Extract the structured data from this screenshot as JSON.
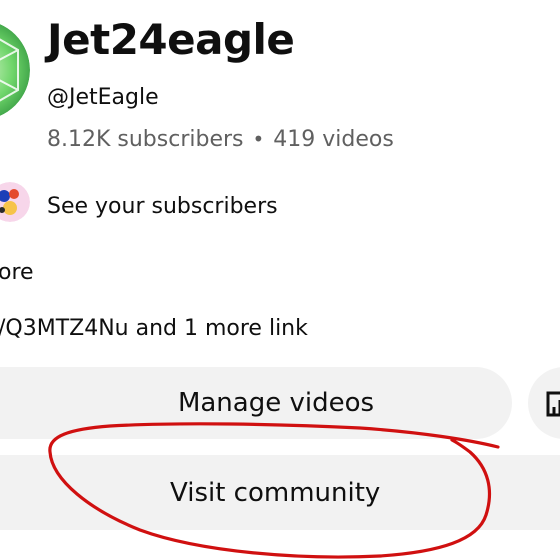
{
  "channel": {
    "name": "Jet24eagle",
    "handle": "@JetEagle",
    "subscribers": "8.12K subscribers",
    "separator": "•",
    "videos": "419 videos"
  },
  "subscribers_link": {
    "label": "See your subscribers"
  },
  "description": {
    "more_text": "ore"
  },
  "links": {
    "text": "/Q3MTZ4Nu and 1 more link"
  },
  "actions": {
    "manage_videos": "Manage videos",
    "visit_community": "Visit community"
  },
  "annotation": {
    "color": "#d01010"
  },
  "icons": {
    "avatar": "channel-avatar",
    "subscriber_avatar": "subscriber-avatar",
    "analytics": "analytics-icon"
  }
}
